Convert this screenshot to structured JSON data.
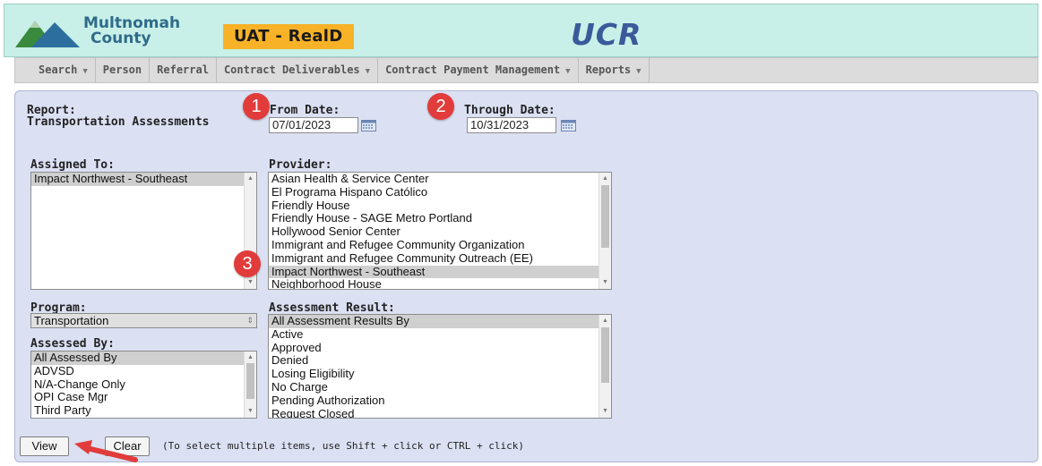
{
  "header": {
    "org_line1": "Multnomah",
    "org_line2": "County",
    "environment": "UAT - RealD",
    "app_name": "UCR"
  },
  "menu": [
    {
      "label": "Search",
      "has_dropdown": true
    },
    {
      "label": "Person",
      "has_dropdown": false
    },
    {
      "label": "Referral",
      "has_dropdown": false
    },
    {
      "label": "Contract Deliverables",
      "has_dropdown": true
    },
    {
      "label": "Contract Payment Management",
      "has_dropdown": true
    },
    {
      "label": "Reports",
      "has_dropdown": true
    }
  ],
  "menu_caret": "▼",
  "report": {
    "label": "Report:",
    "name": "Transportation Assessments"
  },
  "from_date": {
    "label": "From Date:",
    "value": "07/01/2023"
  },
  "through_date": {
    "label": "Through Date:",
    "value": "10/31/2023"
  },
  "assigned_to": {
    "label": "Assigned To:",
    "options": [
      "Impact Northwest - Southeast"
    ],
    "selected_index": 0
  },
  "provider": {
    "label": "Provider:",
    "options": [
      "Asian Health & Service Center",
      "El Programa Hispano Católico",
      "Friendly House",
      "Friendly House - SAGE Metro Portland",
      "Hollywood Senior Center",
      "Immigrant and Refugee Community Organization",
      "Immigrant and Refugee Community Outreach (EE)",
      "Impact Northwest - Southeast",
      "Neighborhood House"
    ],
    "selected_index": 7
  },
  "program": {
    "label": "Program:",
    "value": "Transportation"
  },
  "assessment_result": {
    "label": "Assessment Result:",
    "options": [
      "All Assessment Results By",
      "Active",
      "Approved",
      "Denied",
      "Losing Eligibility",
      "No Charge",
      "Pending Authorization",
      "Request Closed"
    ],
    "selected_index": 0
  },
  "assessed_by": {
    "label": "Assessed By:",
    "options": [
      "All Assessed By",
      "ADVSD",
      "N/A-Change Only",
      "OPI Case Mgr",
      "Third Party"
    ],
    "selected_index": 0
  },
  "buttons": {
    "view": "View",
    "clear": "Clear"
  },
  "hint": "(To select multiple items, use Shift + click or CTRL + click)",
  "markers": [
    "1",
    "2",
    "3"
  ],
  "colors": {
    "header_bg": "#c8f0e8",
    "env_badge": "#f7b227",
    "app_name": "#3a5a9a",
    "panel_bg": "#dbe0f3",
    "marker": "#e23b3b",
    "arrow": "#e23b3b"
  }
}
